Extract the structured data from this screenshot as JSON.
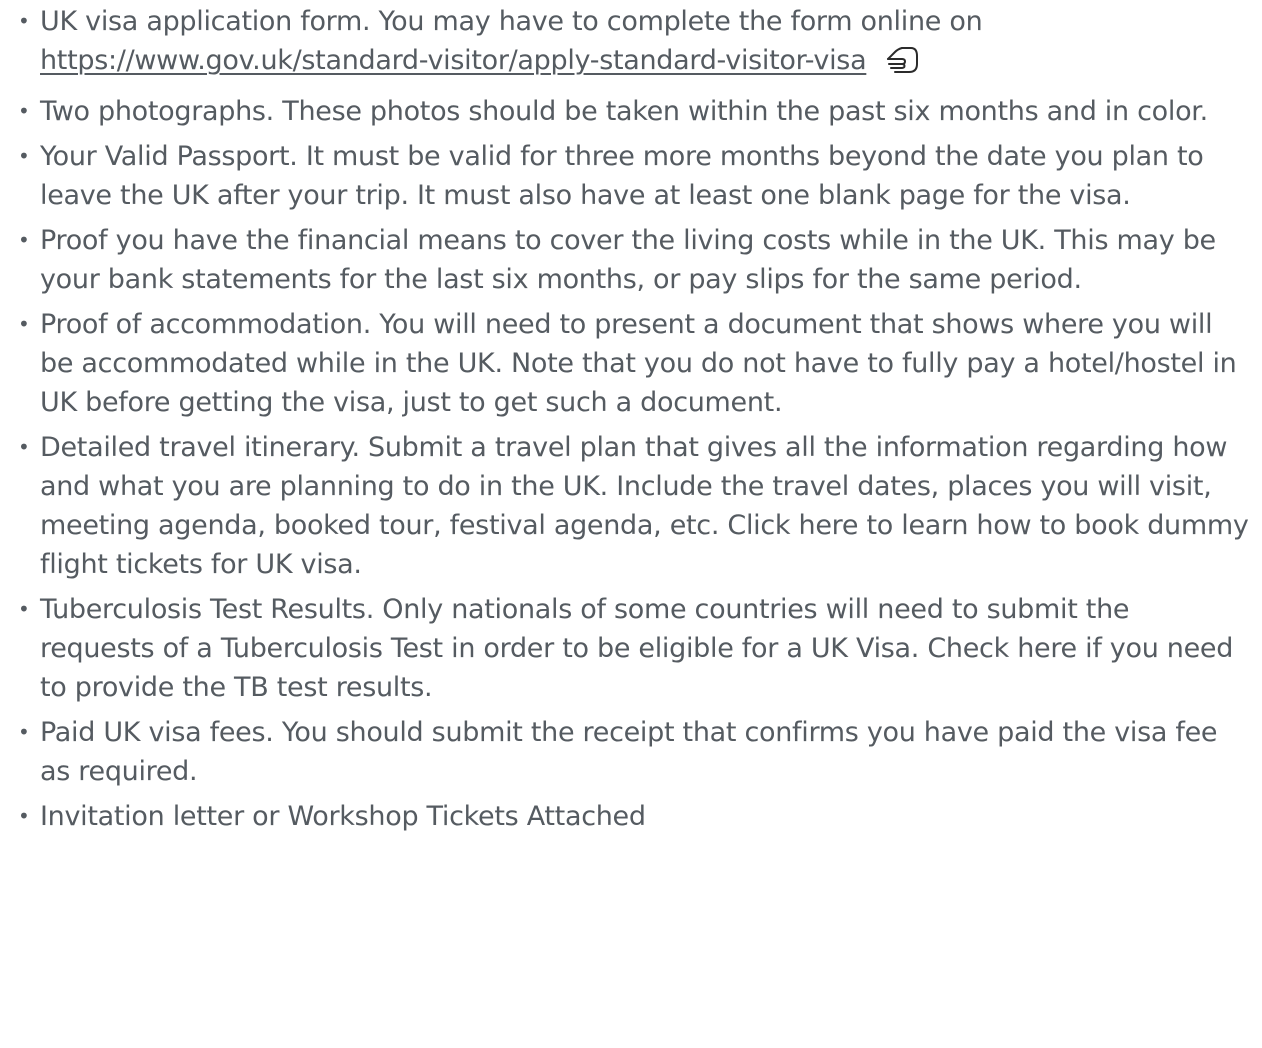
{
  "requirements": [
    {
      "text": "UK visa application form. You may have to complete the form online on",
      "link_text": "https://www.gov.uk/standard-visitor/apply-standard-visitor-visa",
      "icon": "pointing-hand-icon"
    },
    {
      "text": "Two photographs. These photos should be taken within the past six months and in color."
    },
    {
      "text": "Your Valid Passport. It must be valid for three more months beyond the date you plan to leave the UK after your trip. It must also have at least one blank page for the visa."
    },
    {
      "text": "Proof you have the financial means to cover the living costs while in the UK. This may be your bank statements for the last six months, or pay slips for the same period."
    },
    {
      "text": "Proof of accommodation. You will need to present a document that shows where you will be accommodated while in the UK. Note that you do not have to fully pay a hotel/hostel in UK before getting the visa, just to get such a document."
    },
    {
      "text": "Detailed travel itinerary. Submit a travel plan that gives all the information regarding how and what you are planning to do in the UK. Include the travel dates, places you will visit, meeting agenda, booked tour, festival agenda, etc. Click here to learn how to book dummy flight tickets for UK visa."
    },
    {
      "text": "Tuberculosis Test Results.  Only nationals of some countries will need to submit the requests of a Tuberculosis Test in order to be eligible for a UK Visa. Check here if you need to provide the TB test results."
    },
    {
      "text": "Paid UK visa fees. You should submit the receipt that confirms you have paid the visa fee as required."
    },
    {
      "text": "Invitation letter or Workshop Tickets Attached"
    }
  ],
  "colors": {
    "text": "#555b61",
    "background": "#ffffff"
  }
}
